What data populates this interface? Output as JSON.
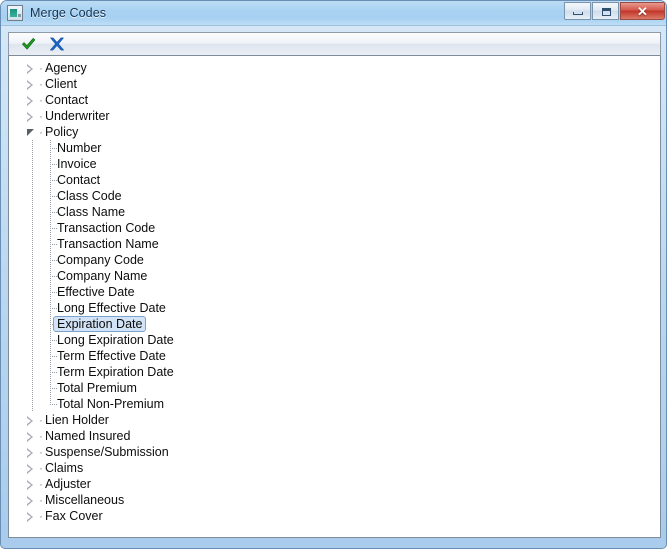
{
  "window": {
    "title": "Merge Codes",
    "icon": "window-merge-icon",
    "caption": {
      "minimize_label": "Minimize",
      "maximize_label": "Maximize",
      "close_label": "✕"
    },
    "accent_title_color": "#a9d2f2",
    "close_button_color": "#c03528"
  },
  "toolbar": {
    "buttons": [
      {
        "name": "accept-button",
        "icon": "checkmark-icon",
        "label": "Accept",
        "color": "#1e9e22"
      },
      {
        "name": "cancel-button",
        "icon": "cross-icon",
        "label": "Cancel",
        "color": "#1b63c4"
      }
    ]
  },
  "tree": {
    "selected_label": "Expiration Date",
    "selection_fill": "#d3e3f7",
    "selection_border": "#7da2cc",
    "nodes": [
      {
        "label": "Agency",
        "level": 0,
        "expanded": false
      },
      {
        "label": "Client",
        "level": 0,
        "expanded": false
      },
      {
        "label": "Contact",
        "level": 0,
        "expanded": false
      },
      {
        "label": "Underwriter",
        "level": 0,
        "expanded": false
      },
      {
        "label": "Policy",
        "level": 0,
        "expanded": true
      },
      {
        "label": "Number",
        "level": 1
      },
      {
        "label": "Invoice",
        "level": 1
      },
      {
        "label": "Contact",
        "level": 1
      },
      {
        "label": "Class Code",
        "level": 1
      },
      {
        "label": "Class Name",
        "level": 1
      },
      {
        "label": "Transaction Code",
        "level": 1
      },
      {
        "label": "Transaction Name",
        "level": 1
      },
      {
        "label": "Company Code",
        "level": 1
      },
      {
        "label": "Company Name",
        "level": 1
      },
      {
        "label": "Effective Date",
        "level": 1
      },
      {
        "label": "Long Effective Date",
        "level": 1
      },
      {
        "label": "Expiration Date",
        "level": 1,
        "selected": true
      },
      {
        "label": "Long Expiration Date",
        "level": 1
      },
      {
        "label": "Term Effective Date",
        "level": 1
      },
      {
        "label": "Term Expiration Date",
        "level": 1
      },
      {
        "label": "Total Premium",
        "level": 1
      },
      {
        "label": "Total Non-Premium",
        "level": 1,
        "last_child": true
      },
      {
        "label": "Lien Holder",
        "level": 0,
        "expanded": false
      },
      {
        "label": "Named Insured",
        "level": 0,
        "expanded": false
      },
      {
        "label": "Suspense/Submission",
        "level": 0,
        "expanded": false
      },
      {
        "label": "Claims",
        "level": 0,
        "expanded": false
      },
      {
        "label": "Adjuster",
        "level": 0,
        "expanded": false
      },
      {
        "label": "Miscellaneous",
        "level": 0,
        "expanded": false
      },
      {
        "label": "Fax Cover",
        "level": 0,
        "expanded": false
      }
    ]
  }
}
